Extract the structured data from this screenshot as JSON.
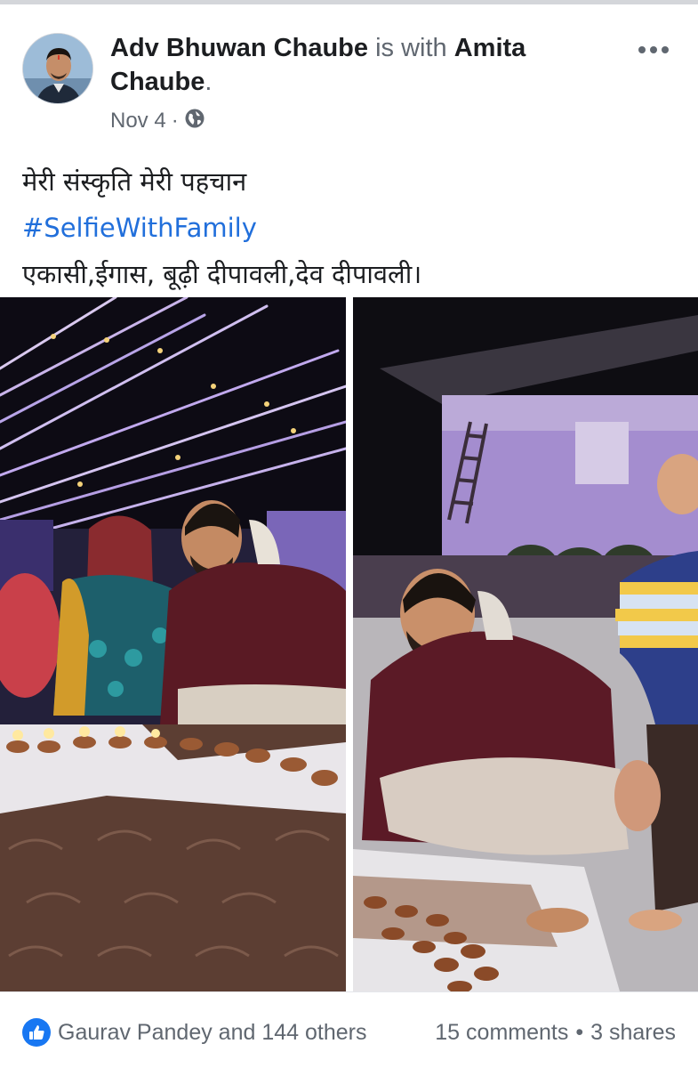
{
  "post": {
    "author": "Adv Bhuwan Chaube",
    "with_text": "is with",
    "tagged": "Amita Chaube",
    "tagged_suffix": ".",
    "date": "Nov 4",
    "date_sep": "·",
    "privacy_icon": "globe-icon",
    "more_icon": "more-dots-icon",
    "text_line_1": "मेरी संस्कृति मेरी पहचान",
    "hashtag": "#SelfieWithFamily",
    "text_line_3": "एकासी,ईगास, बूढ़ी दीपावली,देव दीपावली।"
  },
  "photos": [
    {
      "id": "left",
      "description_icon": "photo-diya-lighting"
    },
    {
      "id": "right",
      "description_icon": "photo-family-diyas"
    }
  ],
  "footer": {
    "reaction_icon": "like-icon",
    "reactions_text": "Gaurav Pandey and 144 others",
    "comments": "15 comments",
    "bullet": "•",
    "shares": "3 shares"
  },
  "colors": {
    "link_blue": "#216fdb",
    "like_blue": "#1877f2",
    "meta_gray": "#606770"
  }
}
